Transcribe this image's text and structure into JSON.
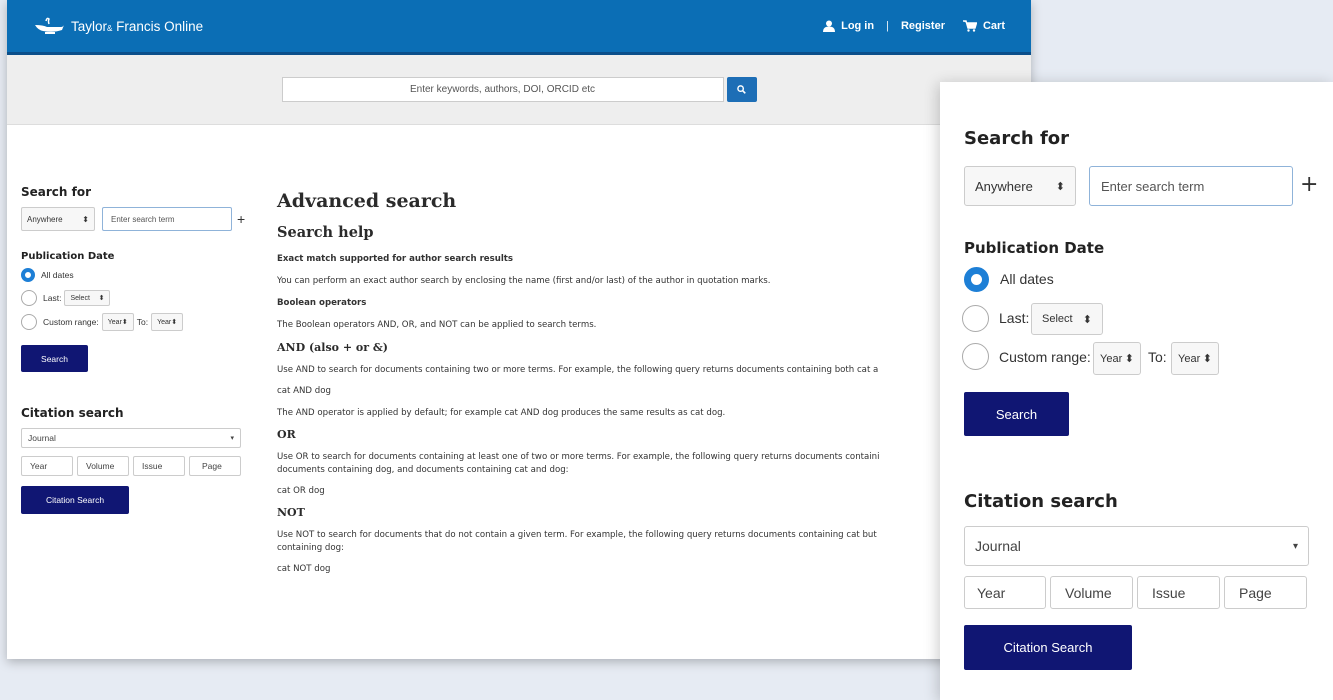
{
  "header": {
    "brand": "Taylor & Francis Online",
    "brand_main": "Taylor",
    "brand_amp": "&",
    "brand_rest": " Francis Online",
    "login": "Log in",
    "separator": "|",
    "register": "Register",
    "cart": "Cart"
  },
  "search": {
    "placeholder": "Enter keywords, authors, DOI, ORCID etc"
  },
  "sidebar": {
    "search_for_title": "Search for",
    "field_select": "Anywhere",
    "term_placeholder": "Enter search term",
    "plus": "+",
    "pub_date_title": "Publication Date",
    "all_dates": "All dates",
    "last_label": "Last:",
    "last_select": "Select",
    "custom_range_label": "Custom range:",
    "year_select": "Year",
    "to_label": "To:",
    "search_button": "Search",
    "citation_title": "Citation search",
    "journal": "Journal",
    "year": "Year",
    "volume": "Volume",
    "issue": "Issue",
    "page": "Page",
    "citation_button": "Citation Search"
  },
  "content": {
    "title": "Advanced search",
    "subtitle": "Search help",
    "exact_heading": "Exact match supported for author search results",
    "exact_text": "You can perform an exact author search by enclosing the name (first and/or last) of the author in quotation marks.",
    "boolean_heading": "Boolean operators",
    "boolean_text": "The Boolean operators AND, OR, and NOT can be applied to search terms.",
    "and_heading": "AND (also + or &)",
    "and_text": "Use AND to search for documents containing two or more terms. For example, the following query returns documents containing both cat a",
    "and_example": "cat AND dog",
    "and_default": "The AND operator is applied by default; for example cat AND dog produces the same results as cat dog.",
    "or_heading": "OR",
    "or_text_1": "Use OR to search for documents containing at least one of two or more terms. For example, the following query returns documents containi",
    "or_text_2": "documents containing dog, and documents containing cat and dog:",
    "or_example": "cat OR dog",
    "not_heading": "NOT",
    "not_text_1": "Use NOT to search for documents that do not contain a given term. For example, the following query returns documents containing cat but",
    "not_text_2": "containing dog:",
    "not_example": "cat NOT dog"
  },
  "colors": {
    "header_blue": "#0b6eb5",
    "navy_button": "#101673",
    "radio_blue": "#1d7fd6"
  }
}
